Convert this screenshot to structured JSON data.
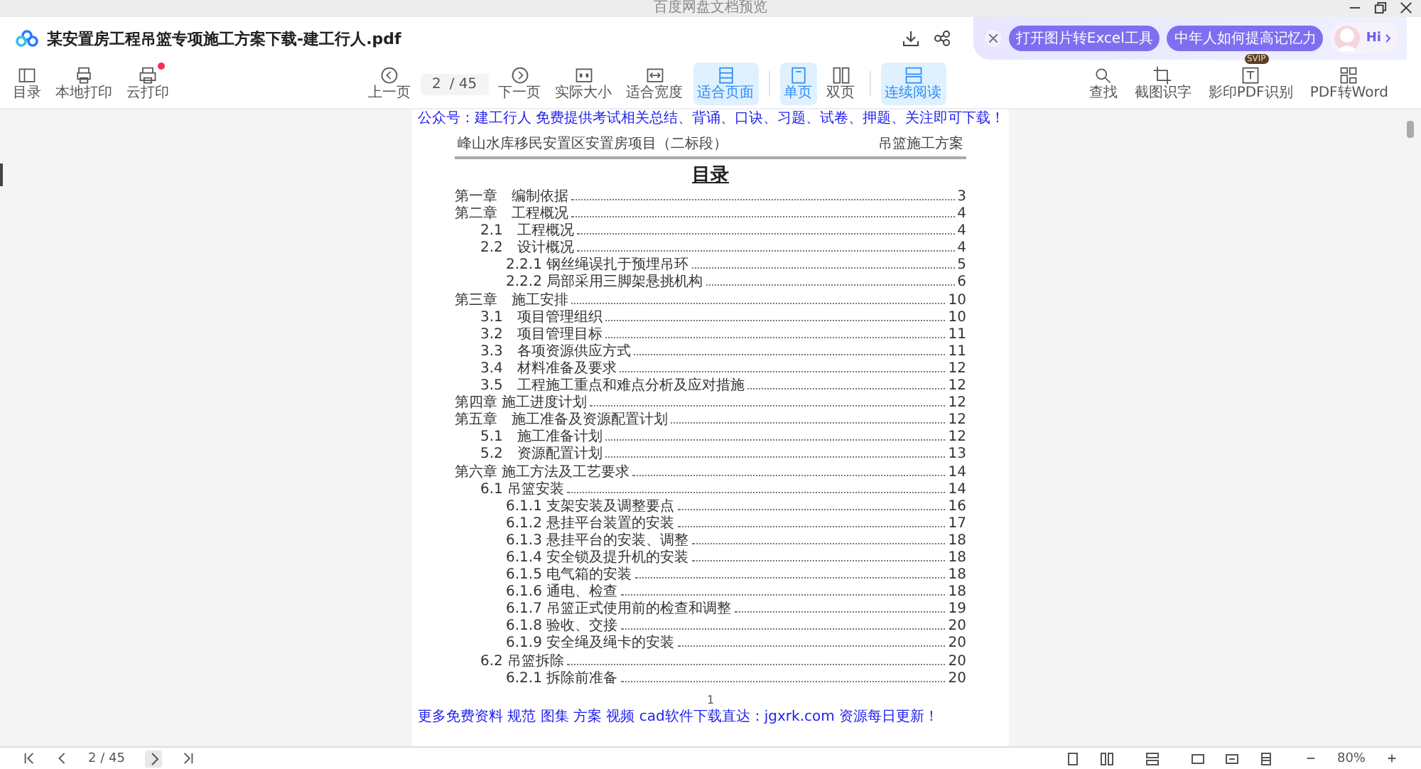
{
  "window": {
    "title": "百度网盘文档预览"
  },
  "header": {
    "file_name": "某安置房工程吊篮专项施工方案下载-建工行人.pdf",
    "promos": [
      "打开图片转Excel工具",
      "中年人如何提高记忆力"
    ],
    "greeting": "Hi"
  },
  "toolbar": {
    "left": [
      {
        "label": "目录",
        "notification": false
      },
      {
        "label": "本地打印",
        "notification": false
      },
      {
        "label": "云打印",
        "notification": true
      }
    ],
    "prev": "上一页",
    "page": "2",
    "page_total": "/ 45",
    "next": "下一页",
    "view": [
      {
        "label": "实际大小",
        "selected": false
      },
      {
        "label": "适合宽度",
        "selected": false
      },
      {
        "label": "适合页面",
        "selected": true
      },
      {
        "label": "单页",
        "selected": true
      },
      {
        "label": "双页",
        "selected": false
      },
      {
        "label": "连续阅读",
        "selected": true
      }
    ],
    "tools": [
      {
        "label": "查找"
      },
      {
        "label": "截图识字"
      },
      {
        "label": "影印PDF识别",
        "badge": "SVIP"
      },
      {
        "label": "PDF转Word"
      }
    ]
  },
  "document": {
    "notice": "公众号：建工行人 免费提供考试相关总结、背诵、口诀、习题、试卷、押题、关注即可下载！",
    "running_header_left": "峰山水库移民安置区安置房项目（二标段）",
    "running_header_right": "吊篮施工方案",
    "toc_title": "目录",
    "toc": [
      {
        "title": "第一章　编制依据",
        "page": "3"
      },
      {
        "title": "第二章　工程概况",
        "page": "4",
        "children": [
          {
            "title": "2.1　工程概况",
            "page": "4"
          },
          {
            "title": "2.2　设计概况",
            "page": "4",
            "children": [
              {
                "title": "2.2.1 钢丝绳误扎于预埋吊环",
                "page": "5"
              },
              {
                "title": "2.2.2 局部采用三脚架悬挑机构",
                "page": "6"
              }
            ]
          }
        ]
      },
      {
        "title": "第三章　施工安排",
        "page": "10",
        "children": [
          {
            "title": "3.1　项目管理组织",
            "page": "10"
          },
          {
            "title": "3.2　项目管理目标",
            "page": "11"
          },
          {
            "title": "3.3　各项资源供应方式",
            "page": "11"
          },
          {
            "title": "3.4　材料准备及要求",
            "page": "12"
          },
          {
            "title": "3.5　工程施工重点和难点分析及应对措施",
            "page": "12"
          }
        ]
      },
      {
        "title": "第四章 施工进度计划",
        "page": "12"
      },
      {
        "title": "第五章　施工准备及资源配置计划",
        "page": "12",
        "children": [
          {
            "title": "5.1　施工准备计划",
            "page": "12"
          },
          {
            "title": "5.2　资源配置计划",
            "page": "13"
          }
        ]
      },
      {
        "title": "第六章 施工方法及工艺要求",
        "page": "14",
        "children": [
          {
            "title": "6.1 吊篮安装",
            "page": "14",
            "children": [
              {
                "title": "6.1.1 支架安装及调整要点",
                "page": "16"
              },
              {
                "title": "6.1.2 悬挂平台装置的安装",
                "page": "17"
              },
              {
                "title": "6.1.3 悬挂平台的安装、调整",
                "page": "18"
              },
              {
                "title": "6.1.4 安全锁及提升机的安装",
                "page": "18"
              },
              {
                "title": "6.1.5 电气箱的安装",
                "page": "18"
              },
              {
                "title": "6.1.6 通电、检查",
                "page": "18"
              },
              {
                "title": "6.1.7 吊篮正式使用前的检查和调整",
                "page": "19"
              },
              {
                "title": "6.1.8 验收、交接",
                "page": "20"
              },
              {
                "title": "6.1.9 安全绳及绳卡的安装",
                "page": "20"
              }
            ]
          },
          {
            "title": "6.2 吊篮拆除",
            "page": "20",
            "children": [
              {
                "title": "6.2.1 拆除前准备",
                "page": "20"
              }
            ]
          }
        ]
      }
    ],
    "page_number": "1",
    "footer_notice": "更多免费资料 规范 图集 方案 视频 cad软件下载直达：jgxrk.com 资源每日更新！"
  },
  "bottom_bar": {
    "page": "2 / 45",
    "zoom": "80%"
  }
}
